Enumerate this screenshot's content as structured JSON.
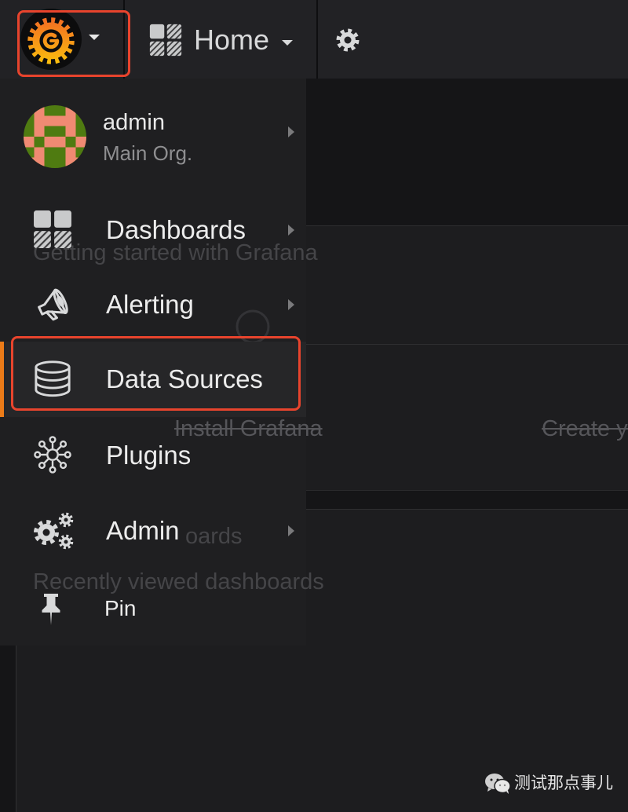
{
  "navbar": {
    "home_label": "Home",
    "icons": {
      "logo": "grafana-logo-icon",
      "home": "dashboards-grid-icon",
      "settings": "gear-icon"
    }
  },
  "sidemenu": {
    "user": {
      "name": "admin",
      "org": "Main Org."
    },
    "items": [
      {
        "label": "Dashboards",
        "icon": "dashboards-grid-icon",
        "has_submenu": true,
        "active": false
      },
      {
        "label": "Alerting",
        "icon": "megaphone-icon",
        "has_submenu": true,
        "active": false
      },
      {
        "label": "Data Sources",
        "icon": "database-icon",
        "has_submenu": false,
        "active": true
      },
      {
        "label": "Plugins",
        "icon": "plugins-icon",
        "has_submenu": false,
        "active": false
      },
      {
        "label": "Admin",
        "icon": "admin-gears-icon",
        "has_submenu": true,
        "active": false
      },
      {
        "label": "Pin",
        "icon": "pin-icon",
        "has_submenu": false,
        "active": false
      }
    ]
  },
  "dashboard": {
    "getting_started": {
      "title": "Getting started with Grafana",
      "steps": [
        {
          "label": "Install Grafana",
          "completed": true
        },
        {
          "label": "Create yo",
          "completed": true
        }
      ]
    },
    "partial_heading": "oards",
    "recent_heading": "Recently viewed dashboards"
  },
  "watermark": {
    "text": "测试那点事儿",
    "icon": "wechat-icon"
  },
  "colors": {
    "active_accent": "#eb7b18",
    "annotation_box": "#e8442d",
    "navbar_bg": "#222225",
    "sidemenu_bg": "#1f1f21",
    "page_bg": "#151517"
  }
}
